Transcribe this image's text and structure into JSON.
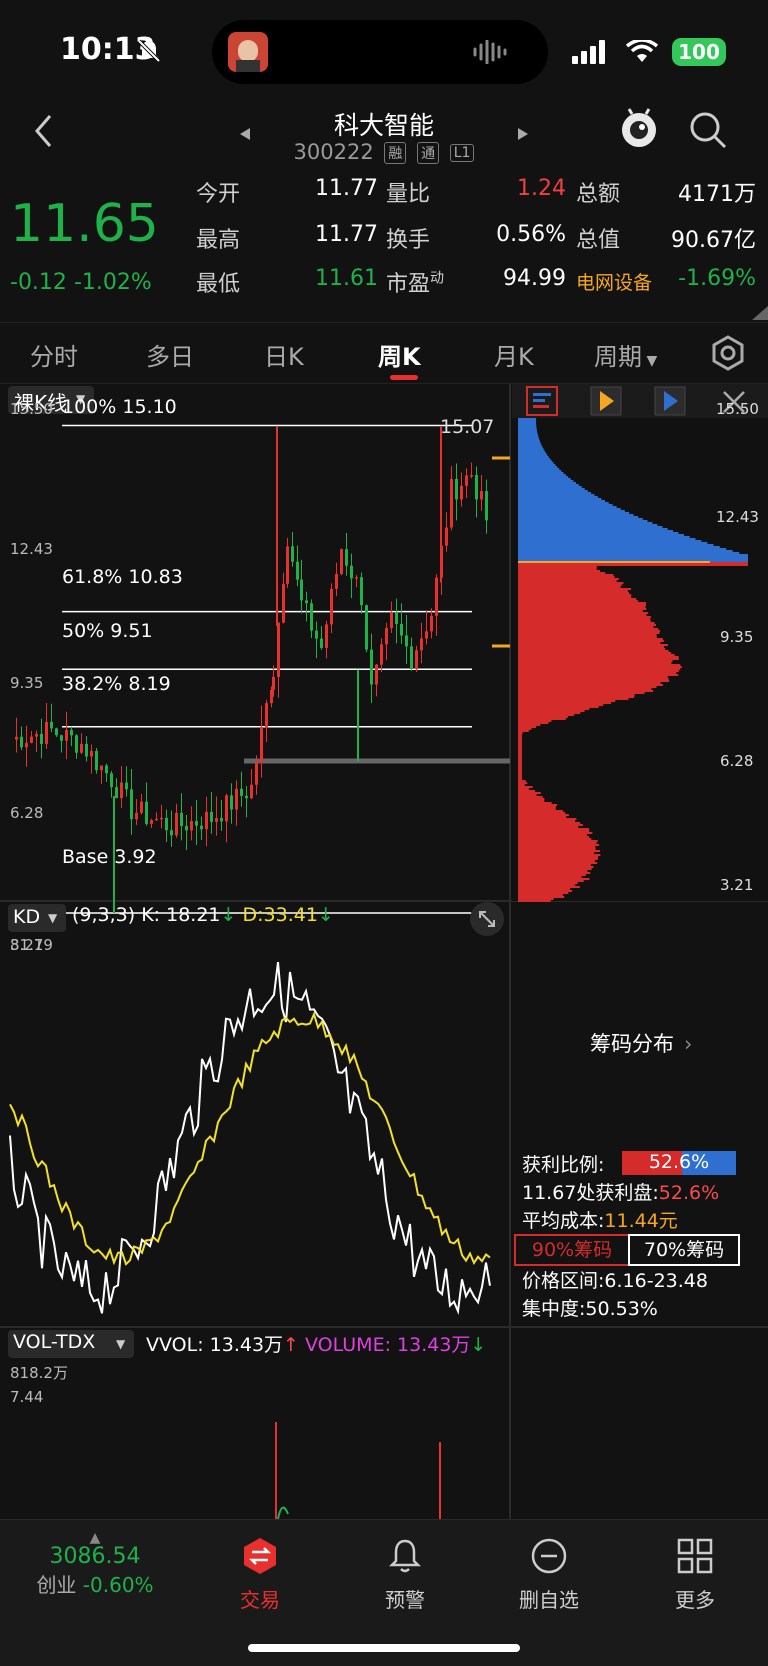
{
  "status": {
    "time": "10:13",
    "battery": "100"
  },
  "nav": {
    "title": "科大智能",
    "code": "300222",
    "badges": [
      "融",
      "通",
      "L1"
    ]
  },
  "quote": {
    "price": "11.65",
    "change": "-0.12",
    "change_pct": "-1.02%",
    "rows": [
      {
        "l1": "今开",
        "v1": "11.77",
        "l2": "量比",
        "v2": "1.24",
        "l3": "总额",
        "v3": "4171万"
      },
      {
        "l1": "最高",
        "v1": "11.77",
        "l2": "换手",
        "v2": "0.56%",
        "l3": "总值",
        "v3": "90.67亿"
      },
      {
        "l1": "最低",
        "v1": "11.61",
        "l2": "市盈",
        "l2_sup": "动",
        "v2": "94.99",
        "l3": "电网设备",
        "v3": "-1.69%"
      }
    ]
  },
  "tabs": [
    "分时",
    "多日",
    "日K",
    "周K",
    "月K",
    "周期"
  ],
  "main_chart": {
    "mode": "裸K线",
    "y_ticks": [
      "15.50",
      "12.43",
      "9.35",
      "6.28",
      "3.21"
    ],
    "high_label": "15.07",
    "fib_levels": [
      {
        "label": "100% 15.10",
        "value": 15.1
      },
      {
        "label": "61.8% 10.83",
        "value": 10.83
      },
      {
        "label": "50% 9.51",
        "value": 9.51
      },
      {
        "label": "38.2% 8.19",
        "value": 8.19
      },
      {
        "label": "Base 3.92",
        "value": 3.92
      }
    ],
    "low_label": "3.92"
  },
  "chip_panel": {
    "y_ticks": [
      "15.50",
      "12.43",
      "9.35",
      "6.28",
      "3.21"
    ],
    "title": "筹码分布",
    "profit_ratio_label": "获利比例:",
    "profit_ratio": "52.6%",
    "profit_at_label": "11.67处获利盘:",
    "profit_at": "52.6%",
    "avg_cost_label": "平均成本:",
    "avg_cost": "11.44元",
    "tab_90": "90%筹码",
    "tab_70": "70%筹码",
    "range_label": "价格区间:",
    "range": "6.16-23.48",
    "concentration_label": "集中度:",
    "concentration": "50.53%",
    "colors": {
      "profit": "#2f6fd0",
      "loss": "#d62b2b"
    }
  },
  "kd": {
    "name": "KD",
    "params": "(9,3,3)",
    "k_text": "K: 18.21",
    "d_text": "D:33.41",
    "top": "81.79",
    "bottom": "7.44"
  },
  "vol": {
    "name": "VOL-TDX",
    "vvol": "VVOL: 13.43万",
    "volume": "VOLUME: 13.43万",
    "top": "818.2万"
  },
  "bottom_nav": {
    "index_value": "3086.54",
    "index_name": "创业",
    "index_change": "-0.60%",
    "items": [
      "交易",
      "预警",
      "删自选",
      "更多"
    ]
  }
}
